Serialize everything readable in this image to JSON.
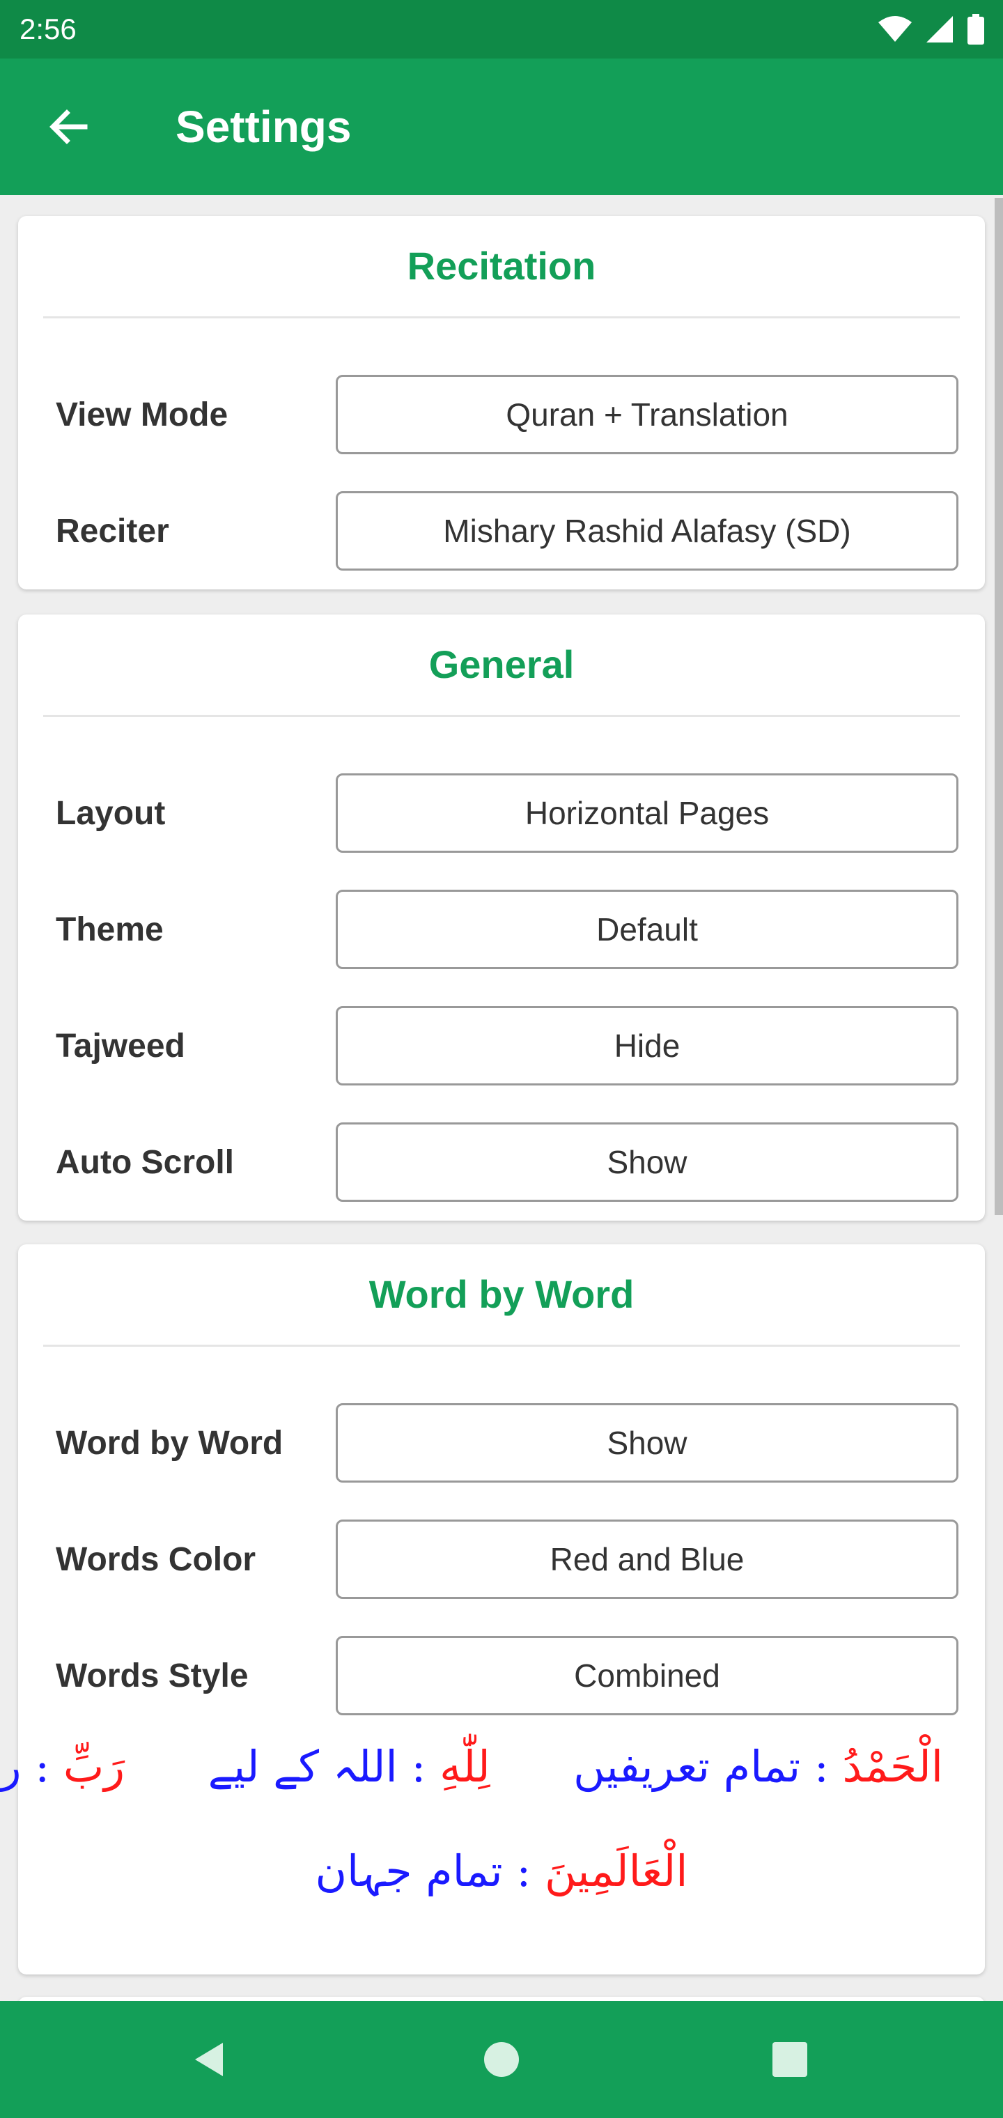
{
  "status_bar": {
    "time": "2:56",
    "icons": [
      "wifi-icon",
      "signal-icon",
      "battery-icon"
    ]
  },
  "app_bar": {
    "title": "Settings",
    "back_icon": "arrow-left-icon"
  },
  "sections": {
    "recitation": {
      "title": "Recitation",
      "rows": [
        {
          "label": "View Mode",
          "value": "Quran + Translation"
        },
        {
          "label": "Reciter",
          "value": "Mishary Rashid Alafasy (SD)"
        }
      ]
    },
    "general": {
      "title": "General",
      "rows": [
        {
          "label": "Layout",
          "value": "Horizontal Pages"
        },
        {
          "label": "Theme",
          "value": "Default"
        },
        {
          "label": "Tajweed",
          "value": "Hide"
        },
        {
          "label": "Auto Scroll",
          "value": "Show"
        }
      ]
    },
    "word_by_word": {
      "title": "Word by Word",
      "rows": [
        {
          "label": "Word by Word",
          "value": "Show"
        },
        {
          "label": "Words Color",
          "value": "Red and Blue"
        },
        {
          "label": "Words Style",
          "value": "Combined"
        }
      ],
      "preview": {
        "words": [
          {
            "arabic": "الْحَمْدُ",
            "separator": ":",
            "translation": "تمام تعریفیں"
          },
          {
            "arabic": "لِلّٰهِ",
            "separator": ":",
            "translation": "اللہ کے لیے"
          },
          {
            "arabic": "رَبِّ",
            "separator": ":",
            "translation": "رب"
          },
          {
            "arabic": "الْعَالَمِينَ",
            "separator": ":",
            "translation": "تمام جہان"
          }
        ]
      }
    }
  },
  "colors": {
    "primary": "#139f58",
    "status_bar": "#0f8a47",
    "arabic_word": "#ff1a1a",
    "translation_word": "#1a1aff"
  },
  "nav_bar": {
    "icons": [
      "back-triangle-icon",
      "home-circle-icon",
      "recents-square-icon"
    ]
  }
}
